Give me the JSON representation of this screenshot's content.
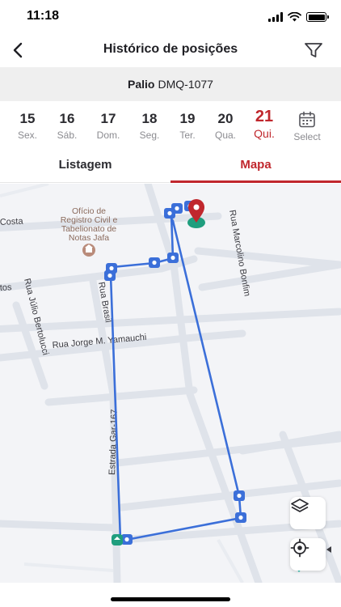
{
  "status_bar": {
    "time": "11:18"
  },
  "header": {
    "title": "Histórico de posições",
    "back_icon": "chevron-left-icon",
    "filter_icon": "filter-icon"
  },
  "vehicle": {
    "model": "Palio",
    "plate": "DMQ-1077"
  },
  "days": [
    {
      "num": "15",
      "dow": "Sex."
    },
    {
      "num": "16",
      "dow": "Sáb."
    },
    {
      "num": "17",
      "dow": "Dom."
    },
    {
      "num": "18",
      "dow": "Seg."
    },
    {
      "num": "19",
      "dow": "Ter."
    },
    {
      "num": "20",
      "dow": "Qua."
    },
    {
      "num": "21",
      "dow": "Qui.",
      "selected": true
    }
  ],
  "select_label": "Select",
  "tabs": {
    "list": "Listagem",
    "map": "Mapa",
    "active": "Mapa"
  },
  "map": {
    "streets": {
      "costa": "Costa",
      "poi_line1": "Ofício de",
      "poi_line2": "Registro Civil e",
      "poi_line3": "Tabelionato de",
      "poi_line4": "Notas Jafa",
      "marcolino": "Rua Marcolino Bonfim",
      "tos": "tos",
      "julio": "Rua Júlio Bertolucci",
      "brasil": "Rua Brasil",
      "jorge": "Rua Jorge M. Yamauchi",
      "estrada": "Estrada Gar-167"
    },
    "colors": {
      "route": "#3b6fd9",
      "end_marker": "#c0272d",
      "start_marker": "#1f9e7e",
      "accent": "#c0272d"
    }
  },
  "controls": {
    "layers_icon": "layers-icon",
    "locate_icon": "locate-icon"
  }
}
